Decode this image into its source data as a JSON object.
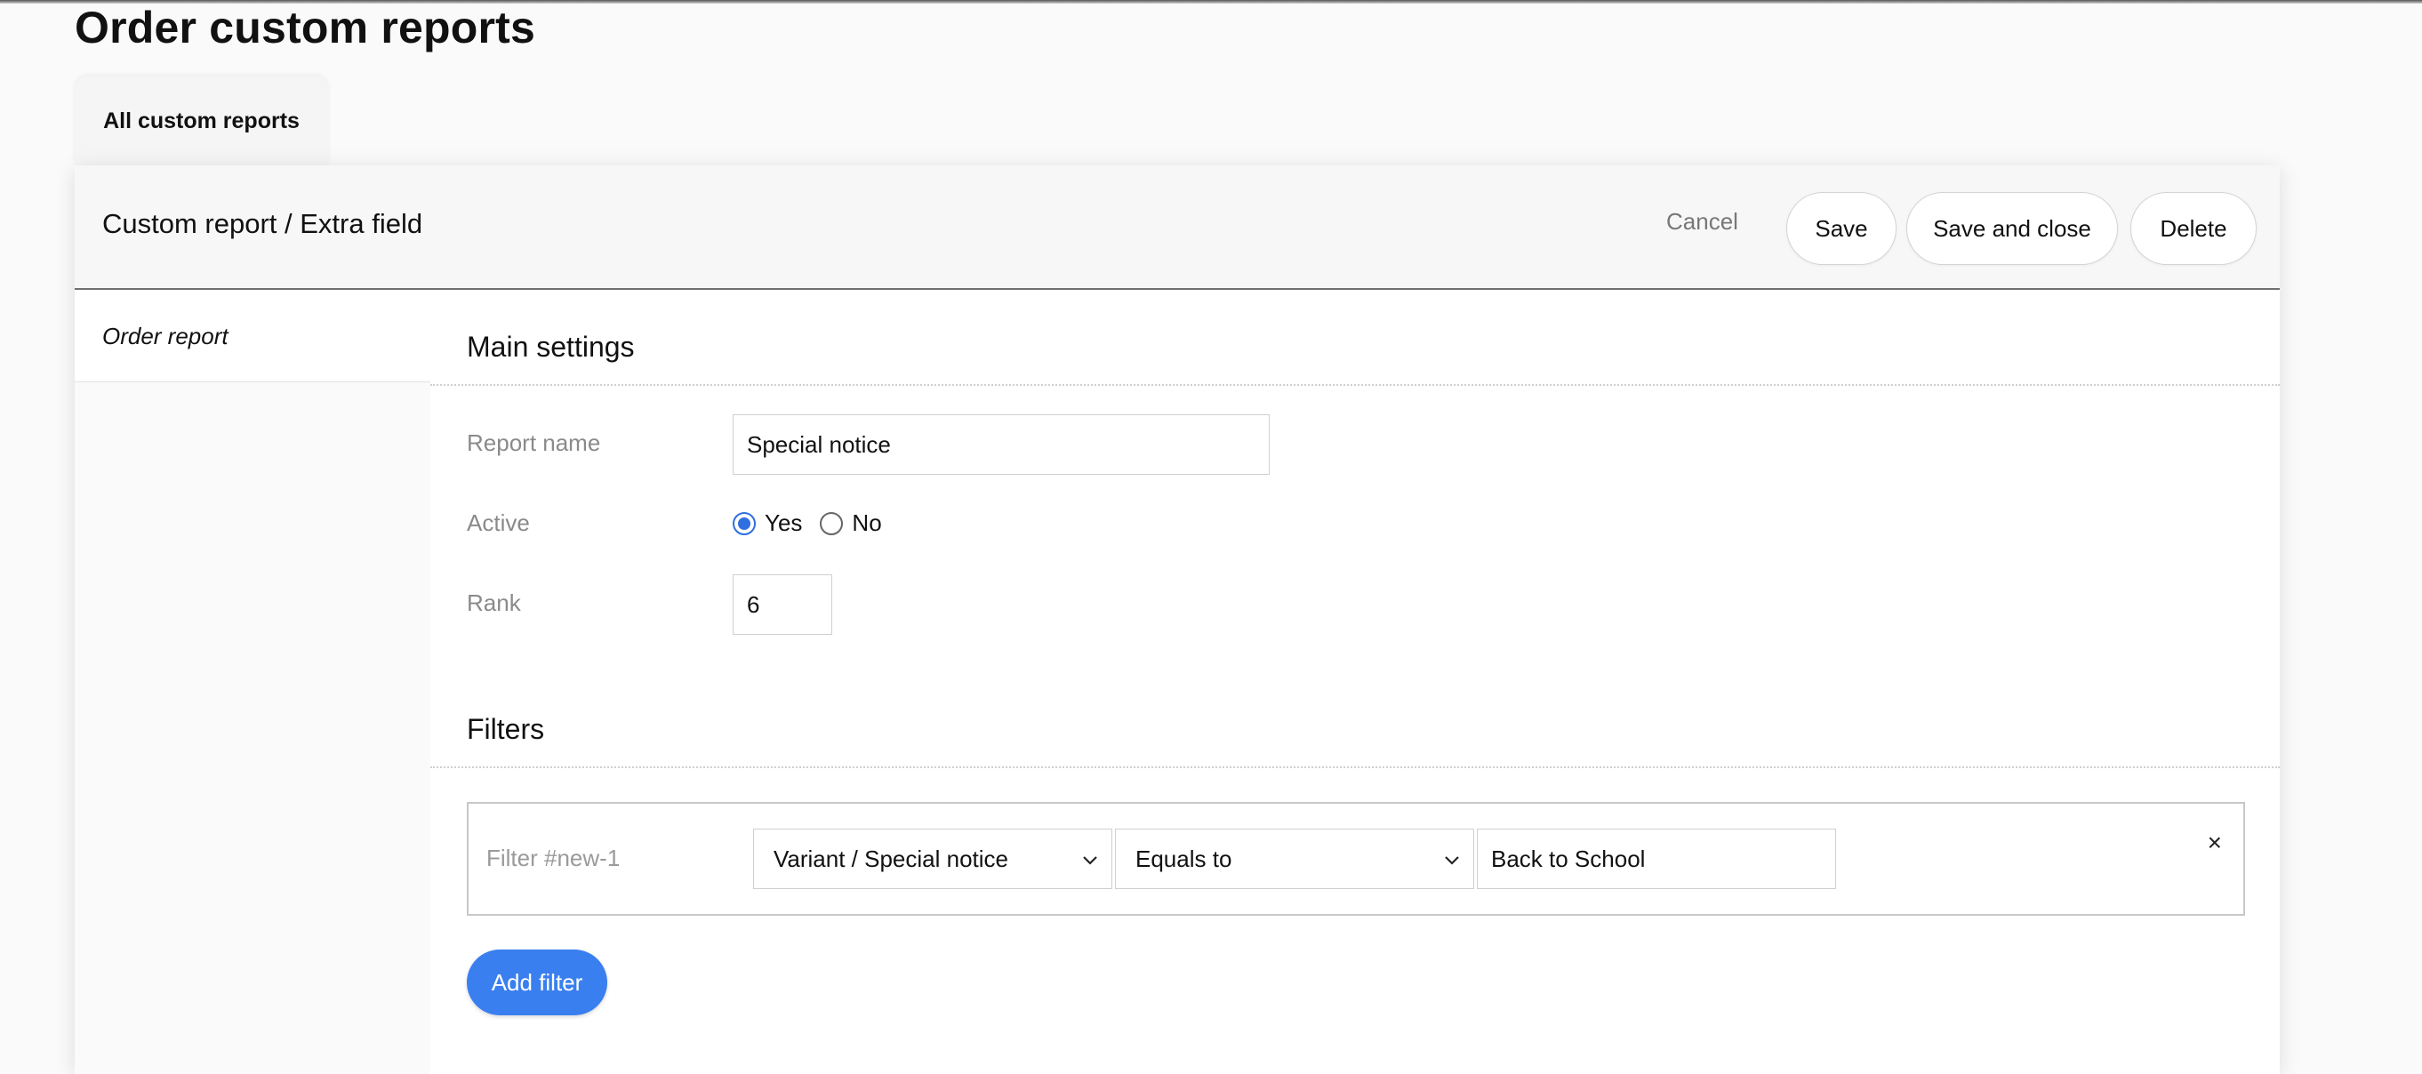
{
  "page": {
    "title": "Order custom reports",
    "tab_label": "All custom reports"
  },
  "header": {
    "title": "Custom report / Extra field",
    "cancel_label": "Cancel",
    "save_label": "Save",
    "save_close_label": "Save and close",
    "delete_label": "Delete"
  },
  "sidebar": {
    "items": [
      {
        "label": "Order report"
      }
    ]
  },
  "main_settings": {
    "heading": "Main settings",
    "report_name_label": "Report name",
    "report_name_value": "Special notice",
    "active_label": "Active",
    "active_options": [
      {
        "label": "Yes",
        "checked": true
      },
      {
        "label": "No",
        "checked": false
      }
    ],
    "rank_label": "Rank",
    "rank_value": "6"
  },
  "filters": {
    "heading": "Filters",
    "items": [
      {
        "label": "Filter #new-1",
        "field": "Variant / Special notice",
        "operator": "Equals to",
        "value": "Back to School",
        "remove_icon": "×"
      }
    ],
    "add_label": "Add filter"
  },
  "colors": {
    "accent": "#3a7ff0",
    "radio_selected": "#2f6fe0"
  },
  "icons": [
    "chevron-down-icon",
    "close-icon"
  ]
}
